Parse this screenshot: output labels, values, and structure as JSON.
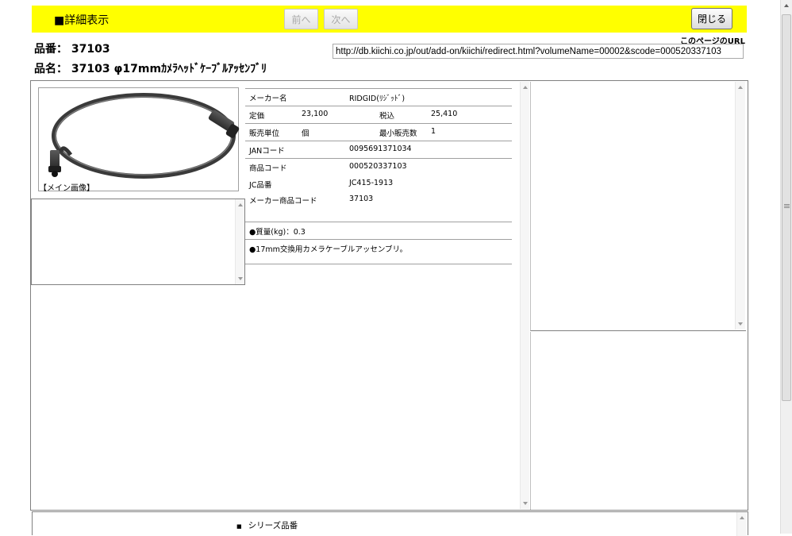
{
  "header": {
    "title": "■詳細表示",
    "prev_label": "前へ",
    "next_label": "次へ",
    "close_label": "閉じる"
  },
  "product": {
    "part_number_line": "品番： 37103",
    "name_line": "品名： 37103 φ17mmｶﾒﾗﾍｯﾄﾞｹｰﾌﾞﾙｱｯｾﾝﾌﾞﾘ",
    "url_caption": "このページのURL",
    "url": "http://db.kiichi.co.jp/out/add-on/kiichi/redirect.html?volumeName=00002&scode=000520337103"
  },
  "image": {
    "caption": "【メイン画像】"
  },
  "specs": {
    "maker_label": "メーカー名",
    "maker_value": "RIDGID(ﾘｼﾞｯﾄﾞ)",
    "list_price_label": "定価",
    "list_price_value": "23,100",
    "tax_incl_label": "税込",
    "tax_incl_value": "25,410",
    "unit_label": "販売単位",
    "unit_value": "個",
    "min_qty_label": "最小販売数",
    "min_qty_value": "1",
    "jan_label": "JANコード",
    "jan_value": "0095691371034",
    "product_code_label": "商品コード",
    "product_code_value": "000520337103",
    "jc_label": "JC品番",
    "jc_value": "JC415-1913",
    "maker_code_label": "メーカー商品コード",
    "maker_code_value": "37103",
    "weight_note": "●質量(kg)：0.3",
    "desc_note": "●17mm交換用カメラケーブルアッセンブリ。"
  },
  "series": {
    "label": "シリーズ品番"
  },
  "colors": {
    "header_bg": "#ffff00"
  }
}
